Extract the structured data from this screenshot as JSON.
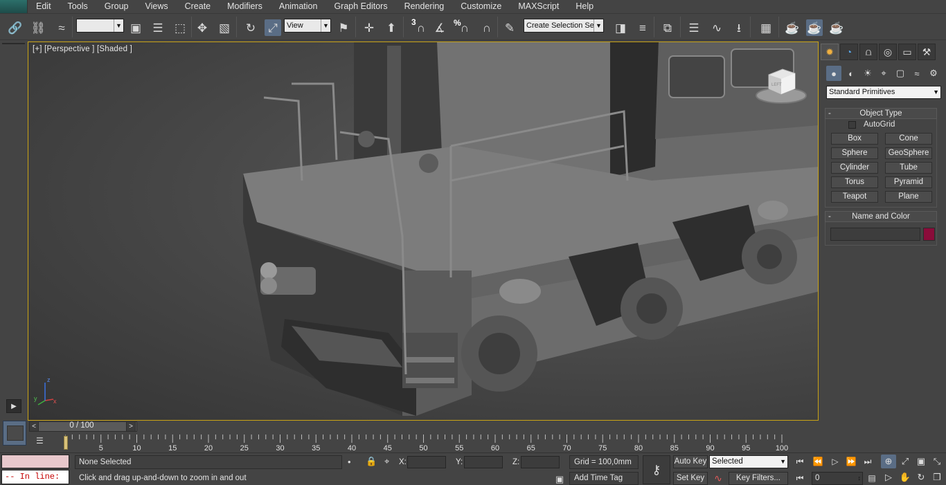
{
  "menu": {
    "items": [
      "Edit",
      "Tools",
      "Group",
      "Views",
      "Create",
      "Modifiers",
      "Animation",
      "Graph Editors",
      "Rendering",
      "Customize",
      "MAXScript",
      "Help"
    ]
  },
  "toolbar": {
    "selection_filter_value": "",
    "reference_coord_value": "View",
    "named_selection_placeholder": "Create Selection Se",
    "snap_badge_3": "3",
    "snap_badge_percent": "%"
  },
  "viewport": {
    "label": "[+] [Perspective ] [Shaded ]",
    "axis_x": "x",
    "axis_y": "y",
    "axis_z": "z",
    "viewcube_face": "LEFT"
  },
  "command_panel": {
    "category": "Standard Primitives",
    "object_type": {
      "title": "Object Type",
      "collapse": "-",
      "autogrid_label": "AutoGrid",
      "autogrid_checked": false,
      "buttons": [
        "Box",
        "Cone",
        "Sphere",
        "GeoSphere",
        "Cylinder",
        "Tube",
        "Torus",
        "Pyramid",
        "Teapot",
        "Plane"
      ]
    },
    "name_and_color": {
      "title": "Name and Color",
      "collapse": "-",
      "name_value": "",
      "color": "#8a0c3a"
    }
  },
  "time_slider": {
    "label": "0 / 100",
    "prev": "<",
    "next": ">"
  },
  "trackbar": {
    "ticks": [
      "5",
      "10",
      "15",
      "20",
      "25",
      "30",
      "35",
      "40",
      "45",
      "50",
      "55",
      "60",
      "65",
      "70",
      "75",
      "80",
      "85",
      "90",
      "95",
      "100"
    ]
  },
  "status": {
    "maxscript_listener_value": "",
    "inline_text": "-- In line:",
    "selection_text": "None Selected",
    "prompt_text": "Click and drag up-and-down to zoom in and out",
    "x_label": "X:",
    "y_label": "Y:",
    "z_label": "Z:",
    "x_value": "",
    "y_value": "",
    "z_value": "",
    "grid_text": "Grid = 100,0mm",
    "add_time_tag": "Add Time Tag",
    "auto_key": "Auto Key",
    "set_key": "Set Key",
    "selected_combo": "Selected",
    "key_filters": "Key Filters...",
    "frame_value": "0"
  },
  "colors": {
    "accent_active": "#5a6d85",
    "viewport_border": "#c9a316",
    "ui_background": "#444444"
  }
}
